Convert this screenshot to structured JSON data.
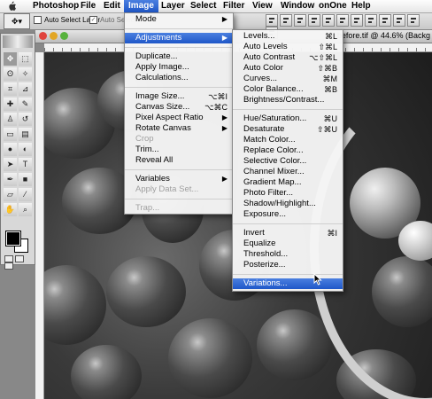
{
  "menubar": {
    "items": [
      "Photoshop",
      "File",
      "Edit",
      "Image",
      "Layer",
      "Select",
      "Filter",
      "View",
      "Window",
      "onOne",
      "Help"
    ],
    "active": "Image"
  },
  "options_bar": {
    "auto_select_layer": "Auto Select Layer",
    "auto_select_groups": "Auto Select"
  },
  "document": {
    "title": "before.tif @ 44.6% (Backg"
  },
  "image_menu": {
    "items": [
      {
        "label": "Mode",
        "submenu": true
      },
      {
        "sep": true
      },
      {
        "label": "Adjustments",
        "submenu": true,
        "highlighted": true
      },
      {
        "sep": true
      },
      {
        "label": "Duplicate..."
      },
      {
        "label": "Apply Image..."
      },
      {
        "label": "Calculations..."
      },
      {
        "sep": true
      },
      {
        "label": "Image Size...",
        "shortcut": "⌥⌘I"
      },
      {
        "label": "Canvas Size...",
        "shortcut": "⌥⌘C"
      },
      {
        "label": "Pixel Aspect Ratio",
        "submenu": true
      },
      {
        "label": "Rotate Canvas",
        "submenu": true
      },
      {
        "label": "Crop",
        "disabled": true
      },
      {
        "label": "Trim..."
      },
      {
        "label": "Reveal All"
      },
      {
        "sep": true
      },
      {
        "label": "Variables",
        "submenu": true
      },
      {
        "label": "Apply Data Set...",
        "disabled": true
      },
      {
        "sep": true
      },
      {
        "label": "Trap...",
        "disabled": true
      }
    ]
  },
  "adjustments_menu": {
    "items": [
      {
        "label": "Levels...",
        "shortcut": "⌘L"
      },
      {
        "label": "Auto Levels",
        "shortcut": "⇧⌘L"
      },
      {
        "label": "Auto Contrast",
        "shortcut": "⌥⇧⌘L"
      },
      {
        "label": "Auto Color",
        "shortcut": "⇧⌘B"
      },
      {
        "label": "Curves...",
        "shortcut": "⌘M"
      },
      {
        "label": "Color Balance...",
        "shortcut": "⌘B"
      },
      {
        "label": "Brightness/Contrast..."
      },
      {
        "sep": true
      },
      {
        "label": "Hue/Saturation...",
        "shortcut": "⌘U"
      },
      {
        "label": "Desaturate",
        "shortcut": "⇧⌘U"
      },
      {
        "label": "Match Color..."
      },
      {
        "label": "Replace Color..."
      },
      {
        "label": "Selective Color..."
      },
      {
        "label": "Channel Mixer..."
      },
      {
        "label": "Gradient Map..."
      },
      {
        "label": "Photo Filter..."
      },
      {
        "label": "Shadow/Highlight..."
      },
      {
        "label": "Exposure..."
      },
      {
        "sep": true
      },
      {
        "label": "Invert",
        "shortcut": "⌘I"
      },
      {
        "label": "Equalize"
      },
      {
        "label": "Threshold..."
      },
      {
        "label": "Posterize..."
      },
      {
        "sep": true
      },
      {
        "label": "Variations...",
        "highlighted": true
      }
    ]
  },
  "colors": {
    "highlight": "#1f57c8",
    "close": "#e0443e",
    "minimize": "#e2a626",
    "zoom": "#57b23c"
  }
}
